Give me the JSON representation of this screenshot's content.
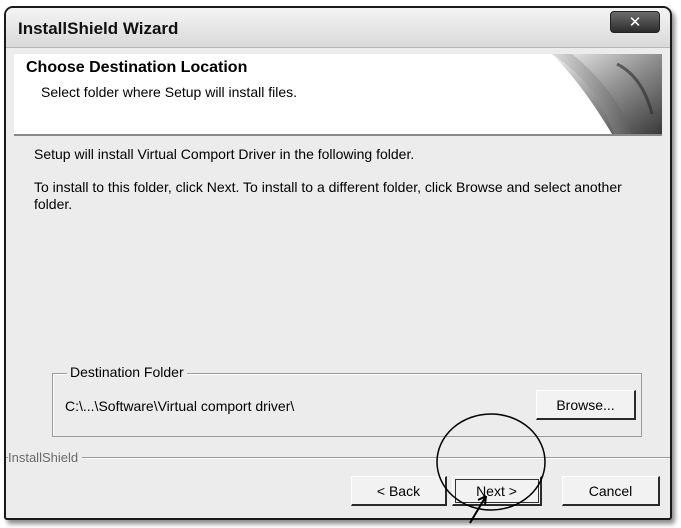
{
  "window": {
    "title": "InstallShield Wizard"
  },
  "header": {
    "title": "Choose Destination Location",
    "subtitle": "Select folder where Setup will install files."
  },
  "body": {
    "line1": "Setup will install Virtual Comport Driver in the following folder.",
    "line2": "To install to this folder, click Next. To install to a different folder, click Browse and select another folder."
  },
  "destination": {
    "legend": "Destination Folder",
    "path": "C:\\...\\Software\\Virtual comport driver\\",
    "browse_label": "Browse..."
  },
  "footer": {
    "brand": "InstallShield",
    "back_label": "< Back",
    "next_label": "Next >",
    "cancel_label": "Cancel"
  },
  "icons": {
    "close": "close-icon",
    "header_art": "page-curl-graphic",
    "highlight": "highlight-circle-arrow"
  },
  "colors": {
    "titlebar": "#dcdcdc",
    "background": "#ececec",
    "close_button": "#3a3a3a"
  }
}
